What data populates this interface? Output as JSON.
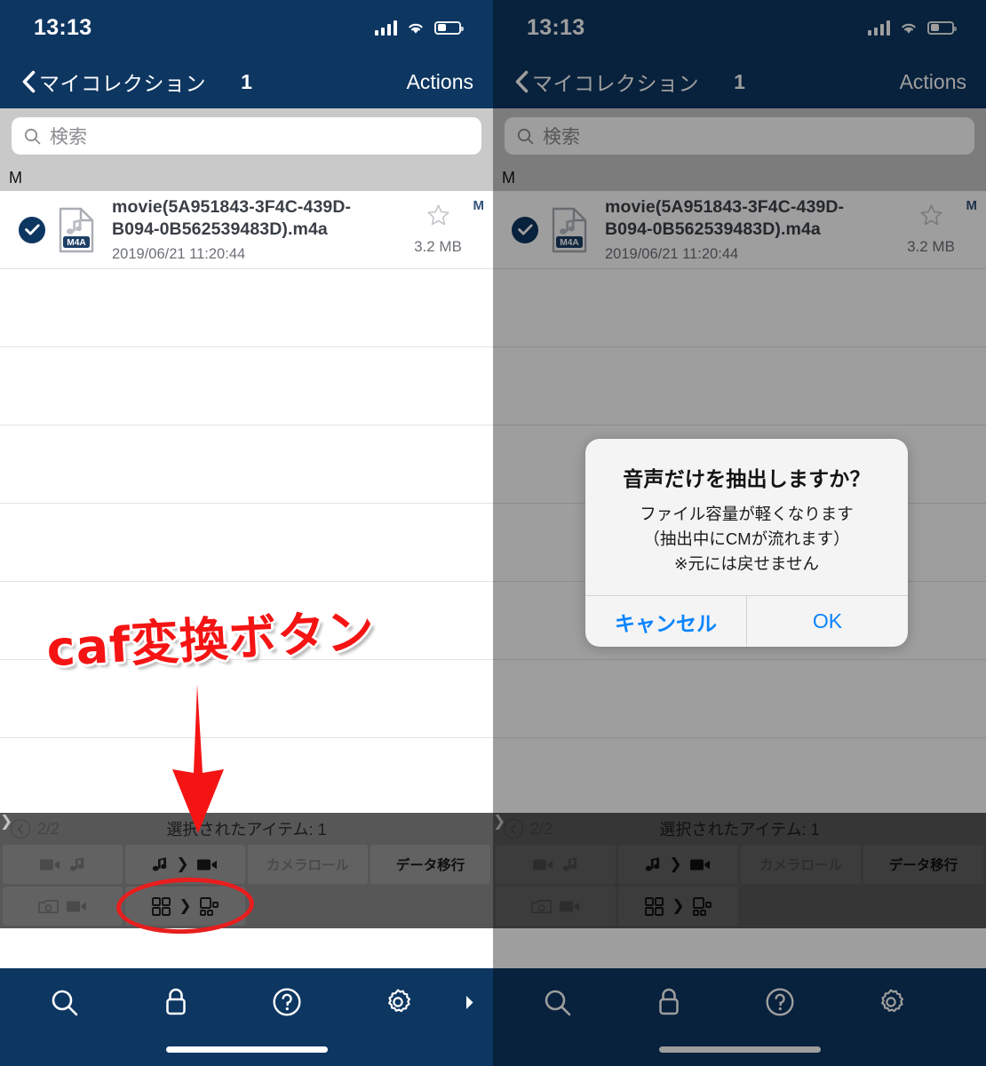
{
  "meta": {
    "accent_navy": "#0d3661",
    "accent_blue": "#0a84ff",
    "annotation_red": "#f51414"
  },
  "status_bar": {
    "time": "13:13",
    "signal_icon": "cellular-bars-icon",
    "wifi_icon": "wifi-icon",
    "battery_icon": "battery-icon"
  },
  "nav": {
    "back_icon": "chevron-left-icon",
    "back_label": "マイコレクション",
    "title": "1",
    "actions_label": "Actions"
  },
  "search": {
    "icon": "search-icon",
    "placeholder": "検索",
    "value": ""
  },
  "section": {
    "header_letter": "M",
    "index_letter": "M"
  },
  "file_row": {
    "checked": true,
    "check_icon": "checkmark-circle-icon",
    "filetype_icon": "m4a-file-icon",
    "filetype_badge": "M4A",
    "name": "movie(5A951843-3F4C-439D-B094-0B562539483D).m4a",
    "date": "2019/06/21 11:20:44",
    "size": "3.2 MB",
    "favorite_icon": "star-outline-icon",
    "favorite": false
  },
  "action_panel": {
    "page_back_icon": "chevron-left-circle-icon",
    "page_indicator": "2/2",
    "selected_label": "選択されたアイテム: 1",
    "buttons": [
      {
        "name": "video-to-audio",
        "from_icon": "video-camera-icon",
        "sep_icon": "chevron-right-icon",
        "to_icon": "music-note-icon",
        "label": "",
        "disabled": true
      },
      {
        "name": "audio-to-video",
        "from_icon": "music-note-icon",
        "sep_icon": "chevron-right-icon",
        "to_icon": "video-camera-icon",
        "label": "",
        "disabled": false
      },
      {
        "name": "camera-roll",
        "from_icon": "",
        "sep_icon": "",
        "to_icon": "",
        "label": "カメラロール",
        "disabled": true
      },
      {
        "name": "data-transfer",
        "from_icon": "",
        "sep_icon": "",
        "to_icon": "",
        "label": "データ移行",
        "disabled": false
      },
      {
        "name": "photo-to-video",
        "from_icon": "camera-folder-icon",
        "sep_icon": "chevron-right-icon",
        "to_icon": "video-camera-icon",
        "label": "",
        "disabled": true
      },
      {
        "name": "caf-convert",
        "from_icon": "grid-four-icon",
        "sep_icon": "chevron-right-icon",
        "to_icon": "grid-mixed-icon",
        "label": "",
        "disabled": false
      }
    ]
  },
  "tab_bar": {
    "tabs": [
      {
        "name": "search",
        "icon": "search-icon"
      },
      {
        "name": "lock",
        "icon": "lock-icon"
      },
      {
        "name": "help",
        "icon": "question-circle-icon"
      },
      {
        "name": "settings",
        "icon": "gear-icon"
      }
    ],
    "more_icon": "caret-right-icon",
    "home_indicator": "home-indicator"
  },
  "dialog": {
    "visible_on": "right",
    "title": "音声だけを抽出しますか？",
    "message_lines": [
      "ファイル容量が軽くなります",
      "（抽出中にCMが流れます）",
      "※元には戻せません"
    ],
    "cancel_label": "キャンセル",
    "ok_label": "OK"
  },
  "annotations": {
    "callout_text": "caf変換ボタン",
    "arrow_icon": "down-arrow-annotation",
    "circle_icon": "ellipse-highlight-annotation"
  }
}
